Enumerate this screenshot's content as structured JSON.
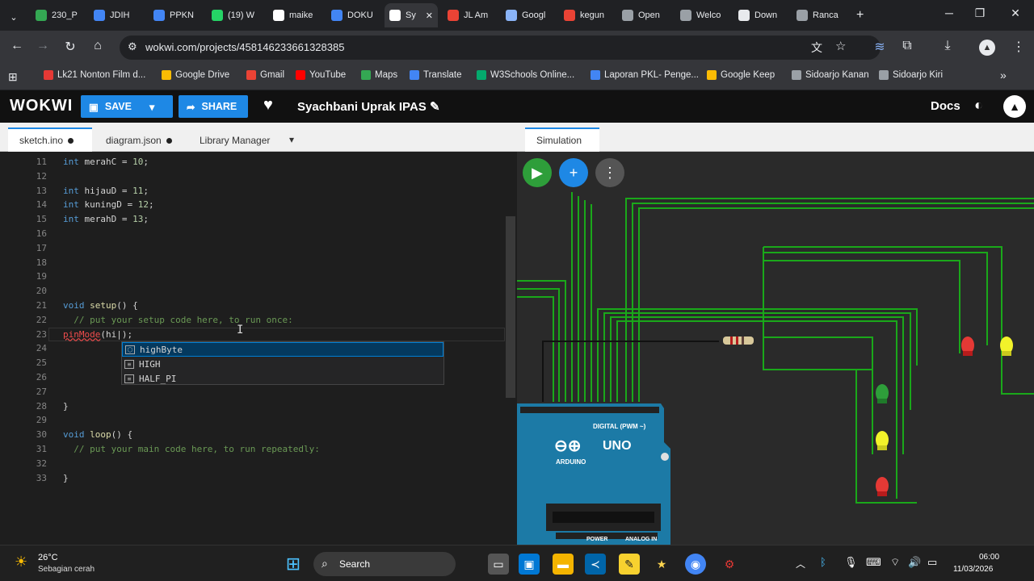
{
  "browser": {
    "tabs": [
      {
        "label": "230_P",
        "color": "#34a853",
        "icon": "sheets-icon"
      },
      {
        "label": "JDIH",
        "color": "#4285f4",
        "icon": "shield-icon"
      },
      {
        "label": "PPKN",
        "color": "#4285f4",
        "icon": "docs-icon"
      },
      {
        "label": "(19) W",
        "color": "#25d366",
        "icon": "whatsapp-icon"
      },
      {
        "label": "maike",
        "color": "#ffffff",
        "icon": "w-icon"
      },
      {
        "label": "DOKU",
        "color": "#4285f4",
        "icon": "docs-icon"
      },
      {
        "label": "Sy",
        "color": "#ffffff",
        "icon": "wokwi-icon"
      },
      {
        "label": "JL Am",
        "color": "#ea4335",
        "icon": "google-icon"
      },
      {
        "label": "Googl",
        "color": "#8ab4f8",
        "icon": "gemini-icon"
      },
      {
        "label": "kegun",
        "color": "#ea4335",
        "icon": "google-icon"
      },
      {
        "label": "Open",
        "color": "#9aa0a6",
        "icon": "openai-icon"
      },
      {
        "label": "Welco",
        "color": "#9aa0a6",
        "icon": "globe-icon"
      },
      {
        "label": "Down",
        "color": "#e8eaed",
        "icon": "download-icon"
      },
      {
        "label": "Ranca",
        "color": "#9aa0a6",
        "icon": "globe-icon"
      }
    ],
    "new_tab": "+",
    "url": "wokwi.com/projects/458146233661328385",
    "bookmarks": [
      {
        "label": "Lk21 Nonton Film d...",
        "color": "#e53935"
      },
      {
        "label": "Google Drive",
        "color": "#fbbc04"
      },
      {
        "label": "Gmail",
        "color": "#ea4335"
      },
      {
        "label": "YouTube",
        "color": "#ff0000"
      },
      {
        "label": "Maps",
        "color": "#34a853"
      },
      {
        "label": "Translate",
        "color": "#4285f4"
      },
      {
        "label": "W3Schools Online...",
        "color": "#04aa6d"
      },
      {
        "label": "Laporan PKL- Penge...",
        "color": "#4285f4"
      },
      {
        "label": "Google Keep",
        "color": "#fbbc04"
      },
      {
        "label": "Sidoarjo Kanan",
        "color": "#9aa0a6"
      },
      {
        "label": "Sidoarjo Kiri",
        "color": "#9aa0a6"
      }
    ]
  },
  "wokwi": {
    "logo": "WOKWI",
    "save": "SAVE",
    "share": "SHARE",
    "project_title": "Syachbani Uprak IPAS",
    "docs": "Docs",
    "editor_tabs": [
      "sketch.ino",
      "diagram.json",
      "Library Manager"
    ],
    "sim_tab": "Simulation"
  },
  "code": {
    "lines": [
      {
        "n": "11",
        "segs": [
          [
            "kw",
            "int"
          ],
          [
            "t",
            " merahC = "
          ],
          [
            "num",
            "10"
          ],
          [
            "t",
            ";"
          ]
        ]
      },
      {
        "n": "12",
        "segs": []
      },
      {
        "n": "13",
        "segs": [
          [
            "kw",
            "int"
          ],
          [
            "t",
            " hijauD = "
          ],
          [
            "num",
            "11"
          ],
          [
            "t",
            ";"
          ]
        ]
      },
      {
        "n": "14",
        "segs": [
          [
            "kw",
            "int"
          ],
          [
            "t",
            " kuningD = "
          ],
          [
            "num",
            "12"
          ],
          [
            "t",
            ";"
          ]
        ]
      },
      {
        "n": "15",
        "segs": [
          [
            "kw",
            "int"
          ],
          [
            "t",
            " merahD = "
          ],
          [
            "num",
            "13"
          ],
          [
            "t",
            ";"
          ]
        ]
      },
      {
        "n": "16",
        "segs": []
      },
      {
        "n": "17",
        "segs": []
      },
      {
        "n": "18",
        "segs": []
      },
      {
        "n": "19",
        "segs": []
      },
      {
        "n": "20",
        "segs": []
      },
      {
        "n": "21",
        "segs": [
          [
            "kw",
            "void"
          ],
          [
            "fn",
            " setup"
          ],
          [
            "t",
            "() {"
          ]
        ]
      },
      {
        "n": "22",
        "segs": [
          [
            "cm",
            "  // put your setup code here, to run once:"
          ]
        ]
      },
      {
        "n": "23",
        "segs": [
          [
            "err",
            "pinMode"
          ],
          [
            "t",
            "(hi|);"
          ]
        ]
      },
      {
        "n": "24",
        "segs": []
      },
      {
        "n": "25",
        "segs": []
      },
      {
        "n": "26",
        "segs": []
      },
      {
        "n": "27",
        "segs": []
      },
      {
        "n": "28",
        "segs": [
          [
            "t",
            "}"
          ]
        ]
      },
      {
        "n": "29",
        "segs": []
      },
      {
        "n": "30",
        "segs": [
          [
            "kw",
            "void"
          ],
          [
            "fn",
            " loop"
          ],
          [
            "t",
            "() {"
          ]
        ]
      },
      {
        "n": "31",
        "segs": [
          [
            "cm",
            "  // put your main code here, to run repeatedly:"
          ]
        ]
      },
      {
        "n": "32",
        "segs": []
      },
      {
        "n": "33",
        "segs": [
          [
            "t",
            "}"
          ]
        ]
      }
    ],
    "suggestions": [
      "highByte",
      "HIGH",
      "HALF_PI"
    ]
  },
  "arduino": {
    "brand": "UNO",
    "sub": "ARDUINO",
    "digital": "DIGITAL (PWM ~)",
    "power": "POWER",
    "analog": "ANALOG IN"
  },
  "leds": {
    "colors": {
      "red": "#e53935",
      "yellow": "#f2f22a",
      "green": "#2e9e3a"
    }
  },
  "taskbar": {
    "temp": "26°C",
    "weather": "Sebagian cerah",
    "search": "Search",
    "time": "06:00",
    "date": "11/03/2026"
  }
}
